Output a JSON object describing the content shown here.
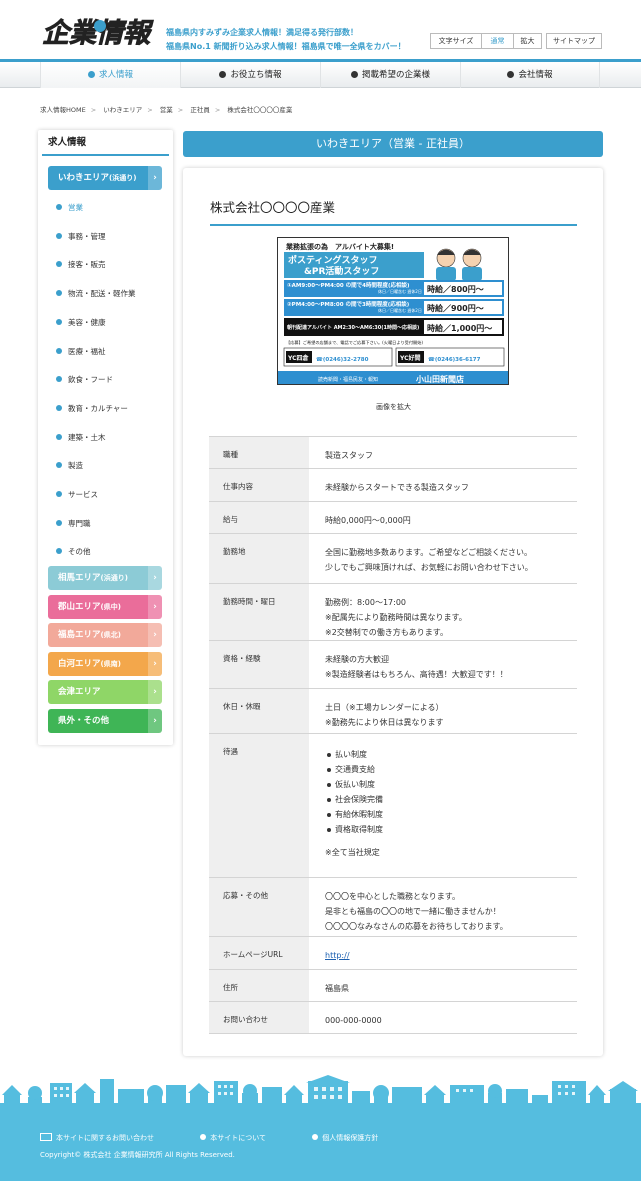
{
  "header": {
    "logo_text": "企業情報",
    "tagline_1": "福島県内すみずみ企業求人情報！満足得る発行部数！",
    "tagline_2": "福島県No.1 新聞折り込み求人情報！福島県で唯一全県をカバー！",
    "font_size_label": "文字サイズ",
    "font_normal": "通常",
    "font_large": "拡大",
    "sitemap": "サイトマップ"
  },
  "nav": [
    {
      "label": "求人情報",
      "active": true
    },
    {
      "label": "お役立ち情報",
      "active": false
    },
    {
      "label": "掲載希望の企業様",
      "active": false
    },
    {
      "label": "会社情報",
      "active": false
    }
  ],
  "breadcrumb": [
    "求人情報HOME",
    "いわきエリア",
    "営業",
    "正社員",
    "株式会社〇〇〇〇産業"
  ],
  "sidebar": {
    "title": "求人情報",
    "areas": [
      {
        "label": "いわきエリア",
        "sub": "(浜通り)",
        "color": "#3b9fcc"
      },
      {
        "label": "相馬エリア",
        "sub": "(浜通り)",
        "color": "#8ccbd6"
      },
      {
        "label": "郡山エリア",
        "sub": "(県中)",
        "color": "#ea6d9a"
      },
      {
        "label": "福島エリア",
        "sub": "(県北)",
        "color": "#f2a99a"
      },
      {
        "label": "白河エリア",
        "sub": "(県南)",
        "color": "#f3a74b"
      },
      {
        "label": "会津エリア",
        "sub": "",
        "color": "#8fd667"
      },
      {
        "label": "県外・その他",
        "sub": "",
        "color": "#3fb556"
      }
    ],
    "categories": [
      "営業",
      "事務・管理",
      "接客・販売",
      "物流・配送・軽作業",
      "美容・健康",
      "医療・福祉",
      "飲食・フード",
      "教育・カルチャー",
      "建築・土木",
      "製造",
      "サービス",
      "専門職",
      "その他"
    ]
  },
  "main": {
    "heading": "いわきエリア（営業 - 正社員）",
    "company": "株式会社〇〇〇〇産業",
    "image_caption": "画像を拡大",
    "ad": {
      "top": "業務拡張の為　アルバイト大募集!",
      "title_1": "ポスティングスタッフ",
      "title_2": "&PR活動スタッフ",
      "shift_1": "①AM9:00〜PM4:00 の間で4時間程度(応相談)",
      "shift_1_days": "休日／日曜含む 週休2日",
      "shift_1_pay": "時給／800円〜",
      "shift_2": "②PM4:00〜PM8:00 の間で3時間程度(応相談)",
      "shift_2_days": "休日／日曜含む 週休2日",
      "shift_2_pay": "時給／900円〜",
      "morning": "朝刊配達アルバイト AM2:30〜AM6:30(1時間〜応相談)",
      "morning_pay": "時給／1,000円〜",
      "apply": "【応募】ご希望の店舗まで、電話でご応募下さい。(火曜日より受付開始)",
      "shop_1": "YC四倉",
      "shop_1_tel": "☎(0246)32-2780",
      "shop_2": "YC好間",
      "shop_2_tel": "☎(0246)36-6177",
      "footer_left": "読売新聞・福島民友・報知",
      "footer_right": "小山田新聞店"
    },
    "rows": [
      {
        "key": "職種",
        "lines": [
          "製造スタッフ"
        ]
      },
      {
        "key": "仕事内容",
        "lines": [
          "未経験からスタートできる製造スタッフ"
        ]
      },
      {
        "key": "給与",
        "lines": [
          "時給0,000円〜0,000円"
        ]
      },
      {
        "key": "勤務地",
        "lines": [
          "全国に勤務地多数あります。ご希望などご相談ください。",
          "少しでもご興味頂ければ、お気軽にお問い合わせ下さい。"
        ]
      },
      {
        "key": "勤務時間・曜日",
        "lines": [
          "勤務例：8:00〜17:00",
          "※配属先により勤務時間は異なります。",
          "※2交替制での働き方もあります。"
        ]
      },
      {
        "key": "資格・経験",
        "lines": [
          "未経験の方大歓迎",
          "※製造経験者はもちろん、高待遇！大歓迎です！！"
        ]
      },
      {
        "key": "休日・休暇",
        "lines": [
          "土日（※工場カレンダーによる）",
          "※勤務先により休日は異なります"
        ]
      },
      {
        "key": "待遇",
        "bullets": [
          "払い制度",
          "交通費支給",
          "仮払い制度",
          "社会保険完備",
          "有給休暇制度",
          "資格取得制度"
        ],
        "note": "※全て当社規定"
      },
      {
        "key": "応募・その他",
        "lines": [
          "〇〇〇を中心とした職務となります。",
          "是非とも福島の〇〇の地で一緒に働きませんか！",
          "〇〇〇〇なみなさんの応募をお待ちしております。"
        ]
      },
      {
        "key": "ホームページURL",
        "link": "http://"
      },
      {
        "key": "住所",
        "lines": [
          "福島県"
        ]
      },
      {
        "key": "お問い合わせ",
        "lines": [
          "000-000-0000"
        ]
      }
    ]
  },
  "footer": {
    "links": [
      "本サイトに関するお問い合わせ",
      "本サイトについて",
      "個人情報保護方針"
    ],
    "copyright": "Copyright© 株式会社 企業情報研究所 All Rights Reserved."
  }
}
